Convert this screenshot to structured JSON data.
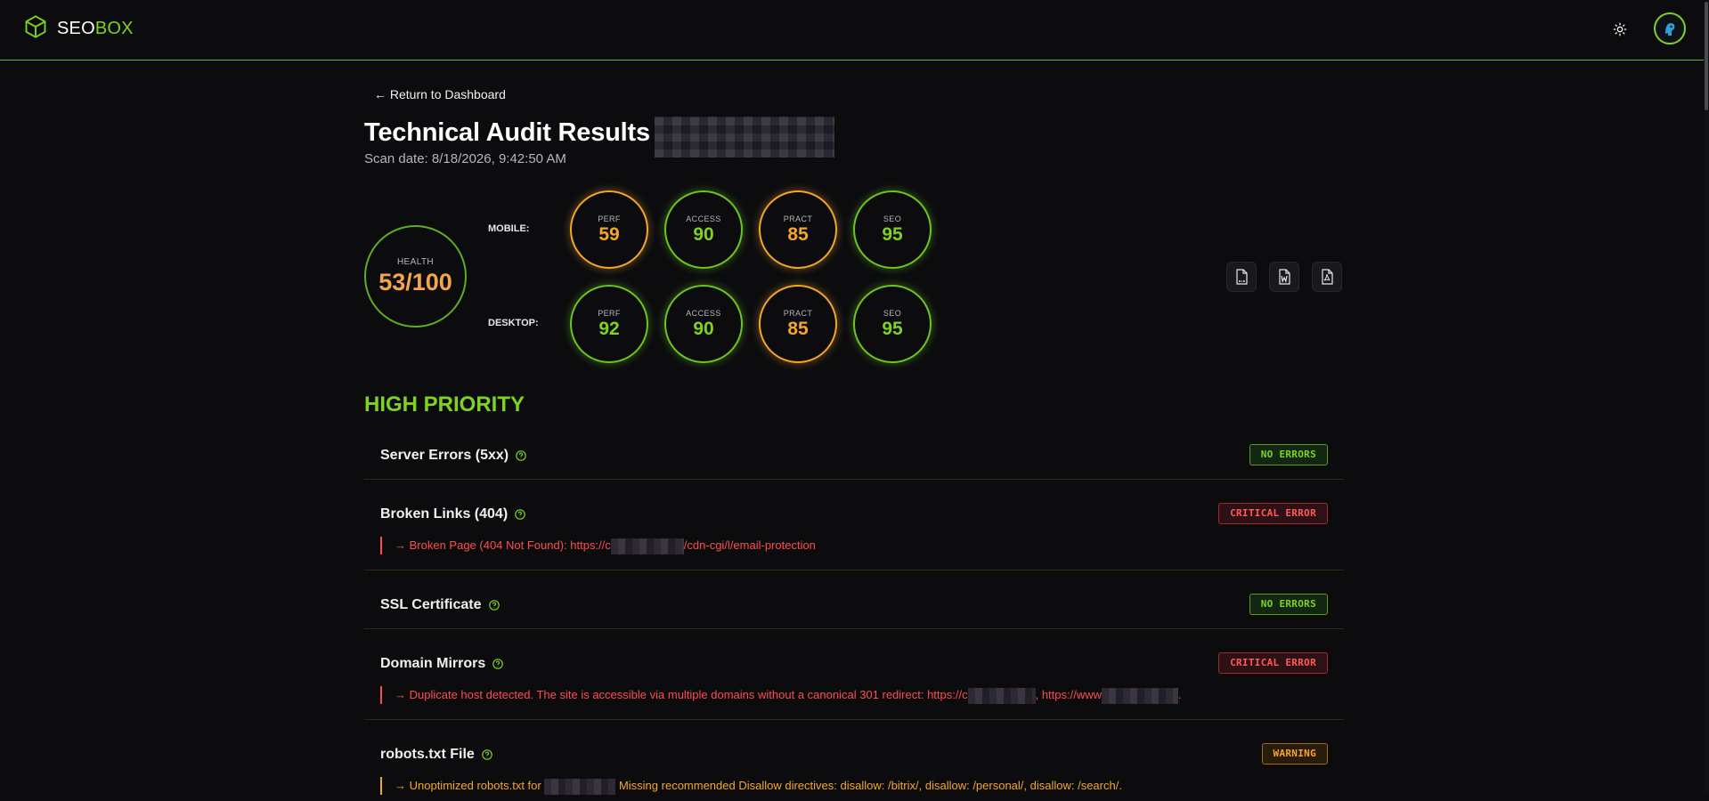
{
  "header": {
    "logo_part1": "SEO",
    "logo_part2": "BOX",
    "logo_icon": "cube-icon",
    "theme_icon": "sun-icon",
    "avatar_icon": "user-avatar-icon"
  },
  "nav": {
    "back_label": "← Return to Dashboard"
  },
  "page": {
    "title": "Technical Audit Results",
    "scan_date": "Scan date: 8/18/2026, 9:42:50 AM"
  },
  "health": {
    "label": "HEALTH",
    "value": "53/100"
  },
  "scores": {
    "mobile": {
      "label": "MOBILE:",
      "items": [
        {
          "label": "PERF",
          "value": "59",
          "status": "orange"
        },
        {
          "label": "ACCESS",
          "value": "90",
          "status": "green"
        },
        {
          "label": "PRACT",
          "value": "85",
          "status": "orange"
        },
        {
          "label": "SEO",
          "value": "95",
          "status": "green"
        }
      ]
    },
    "desktop": {
      "label": "DESKTOP:",
      "items": [
        {
          "label": "PERF",
          "value": "92",
          "status": "green"
        },
        {
          "label": "ACCESS",
          "value": "90",
          "status": "green"
        },
        {
          "label": "PRACT",
          "value": "85",
          "status": "orange"
        },
        {
          "label": "SEO",
          "value": "95",
          "status": "green"
        }
      ]
    }
  },
  "exports": [
    "csv-file-icon",
    "word-file-icon",
    "pdf-file-icon"
  ],
  "section": {
    "title": "HIGH PRIORITY"
  },
  "checks": [
    {
      "name": "Server Errors (5xx)",
      "badge": "NO ERRORS"
    },
    {
      "name": "Broken Links (404)",
      "badge": "CRITICAL ERROR",
      "detail_a": "→ Broken Page (404 Not Found): https://c",
      "detail_b": "/cdn-cgi/l/email-protection"
    },
    {
      "name": "SSL Certificate",
      "badge": "NO ERRORS"
    },
    {
      "name": "Domain Mirrors",
      "badge": "CRITICAL ERROR",
      "detail_a": "→ Duplicate host detected. The site is accessible via multiple domains without a canonical 301 redirect: https://c",
      "detail_b": ", https://www",
      "detail_c": "."
    },
    {
      "name": "robots.txt File",
      "badge": "WARNING",
      "detail_a": "→ Unoptimized robots.txt for ",
      "detail_b": " Missing recommended Disallow directives: disallow: /bitrix/, disallow: /personal/, disallow: /search/."
    }
  ],
  "colors": {
    "accent": "#7ed321",
    "warning": "#f5a62a",
    "error": "#ff4d4d",
    "background": "#0c0c0f"
  }
}
